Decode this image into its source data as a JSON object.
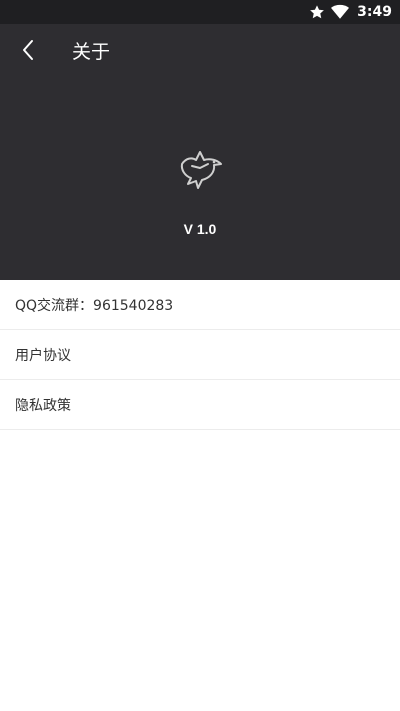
{
  "status_bar": {
    "time": "3:49",
    "icons": [
      "star-icon",
      "wifi-icon"
    ]
  },
  "header": {
    "back_icon": "chevron-left-icon",
    "title": "关于",
    "logo_icon": "dove-icon",
    "version": "V 1.0",
    "background_color": "#2e2d31"
  },
  "list": {
    "items": [
      {
        "label": "QQ交流群：961540283"
      },
      {
        "label": "用户协议"
      },
      {
        "label": "隐私政策"
      }
    ]
  }
}
